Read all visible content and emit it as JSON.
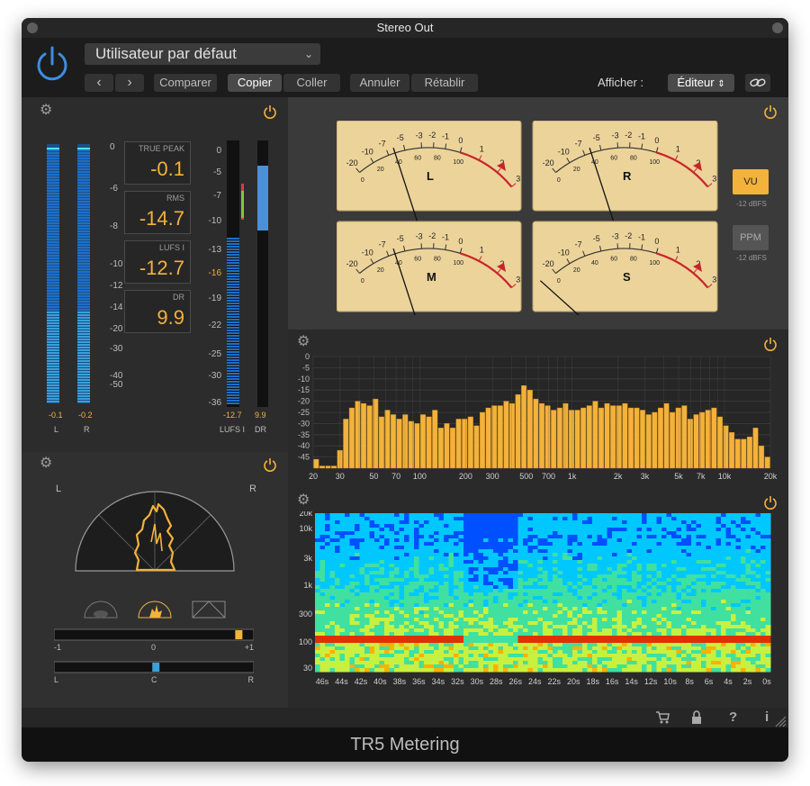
{
  "window": {
    "title": "Stereo Out",
    "footer": "TR5 Metering"
  },
  "header": {
    "preset": "Utilisateur par défaut",
    "prev_label": "‹",
    "next_label": "›",
    "compare": "Comparer",
    "copy": "Copier",
    "paste": "Coller",
    "undo": "Annuler",
    "redo": "Rétablir",
    "view_label": "Afficher :",
    "view_value": "Éditeur"
  },
  "level_meter": {
    "scale": [
      "0",
      "-6",
      "-8",
      "-10",
      "-12",
      "-14",
      "-20",
      "-30",
      "-40",
      "-50"
    ],
    "left_value": "-0.1",
    "right_value": "-0.2",
    "left_channel": "L",
    "right_channel": "R",
    "true_peak_label": "TRUE PEAK",
    "true_peak": "-0.1",
    "rms_label": "RMS",
    "rms": "-14.7",
    "lufs_label": "LUFS I",
    "lufs": "-12.7",
    "dr_label": "DR",
    "dr": "9.9",
    "loud_scale": [
      "0",
      "-5",
      "-7",
      "-10",
      "-13",
      "-16",
      "-19",
      "-22",
      "-25",
      "-30",
      "-36"
    ],
    "lufs_value": "-12.7",
    "dr_value": "9.9",
    "lufs_caption": "LUFS I",
    "dr_caption": "DR"
  },
  "vu": {
    "scale": [
      "-20",
      "-10",
      "-7",
      "-5",
      "-3",
      "-2",
      "-1",
      "0",
      "1",
      "2",
      "3"
    ],
    "inner_scale": [
      "0",
      "20",
      "40",
      "60",
      "80",
      "100"
    ],
    "meters": [
      {
        "label": "L",
        "needle": -18
      },
      {
        "label": "R",
        "needle": -18
      },
      {
        "label": "M",
        "needle": -18
      },
      {
        "label": "S",
        "needle": -48
      }
    ],
    "vu_label": "VU",
    "vu_ref": "-12 dBFS",
    "ppm_label": "PPM",
    "ppm_ref": "-12 dBFS"
  },
  "stereo": {
    "left": "L",
    "right": "R",
    "corr_scale": [
      "-1",
      "0",
      "+1"
    ],
    "correlation": 0.85,
    "bal_scale": [
      "L",
      "C",
      "R"
    ],
    "balance": 0.02
  },
  "chart_data": [
    {
      "type": "bar",
      "x": [
        "20",
        "30",
        "50",
        "70",
        "100",
        "200",
        "300",
        "500",
        "700",
        "1k",
        "2k",
        "3k",
        "5k",
        "7k",
        "10k",
        "20k"
      ],
      "ylim": [
        -50,
        0
      ],
      "yticks": [
        "0",
        "-5",
        "-10",
        "-15",
        "-20",
        "-25",
        "-30",
        "-35",
        "-40",
        "-45"
      ],
      "values": [
        -46,
        -49,
        -49,
        -49,
        -42,
        -28,
        -23,
        -20,
        -21,
        -22,
        -19,
        -27,
        -24,
        -26,
        -28,
        -26,
        -29,
        -30,
        -26,
        -27,
        -24,
        -32,
        -30,
        -32,
        -28,
        -28,
        -27,
        -31,
        -25,
        -23,
        -22,
        -22,
        -20,
        -21,
        -17,
        -13,
        -15,
        -19,
        -21,
        -22,
        -24,
        -23,
        -21,
        -24,
        -24,
        -23,
        -22,
        -20,
        -23,
        -21,
        -22,
        -22,
        -21,
        -23,
        -23,
        -24,
        -26,
        -25,
        -23,
        -21,
        -25,
        -23,
        -22,
        -28,
        -26,
        -25,
        -24,
        -23,
        -27,
        -31,
        -34,
        -37,
        -37,
        -36,
        -32,
        -40,
        -45
      ]
    },
    {
      "type": "heatmap",
      "yticks": [
        "20k",
        "10k",
        "3k",
        "1k",
        "300",
        "100",
        "30"
      ],
      "xticks": [
        "46s",
        "44s",
        "42s",
        "40s",
        "38s",
        "36s",
        "34s",
        "32s",
        "30s",
        "28s",
        "26s",
        "24s",
        "22s",
        "20s",
        "18s",
        "16s",
        "14s",
        "12s",
        "10s",
        "8s",
        "6s",
        "4s",
        "2s",
        "0s"
      ]
    }
  ]
}
